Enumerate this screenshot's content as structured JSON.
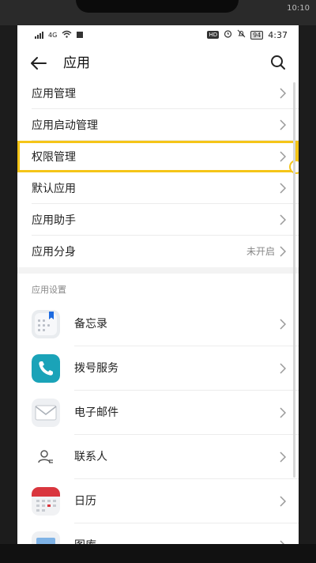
{
  "outer_status": {
    "carrier_left": "",
    "time": "10:10"
  },
  "status_bar": {
    "network_label": "4G",
    "battery": "94",
    "time": "4:37",
    "hd": "HD"
  },
  "header": {
    "title": "应用"
  },
  "menu": {
    "items": [
      {
        "label": "应用管理",
        "value": ""
      },
      {
        "label": "应用启动管理",
        "value": ""
      },
      {
        "label": "权限管理",
        "value": ""
      },
      {
        "label": "默认应用",
        "value": ""
      },
      {
        "label": "应用助手",
        "value": ""
      },
      {
        "label": "应用分身",
        "value": "未开启"
      }
    ]
  },
  "app_settings": {
    "section_label": "应用设置",
    "apps": [
      {
        "label": "备忘录",
        "icon": "notes-icon"
      },
      {
        "label": "拨号服务",
        "icon": "phone-icon"
      },
      {
        "label": "电子邮件",
        "icon": "mail-icon"
      },
      {
        "label": "联系人",
        "icon": "contacts-icon"
      },
      {
        "label": "日历",
        "icon": "calendar-icon"
      },
      {
        "label": "图库",
        "icon": "gallery-icon"
      }
    ]
  },
  "colors": {
    "highlight": "#f5c518",
    "phone_icon": "#1aa3b8",
    "calendar_red": "#d9363e"
  }
}
